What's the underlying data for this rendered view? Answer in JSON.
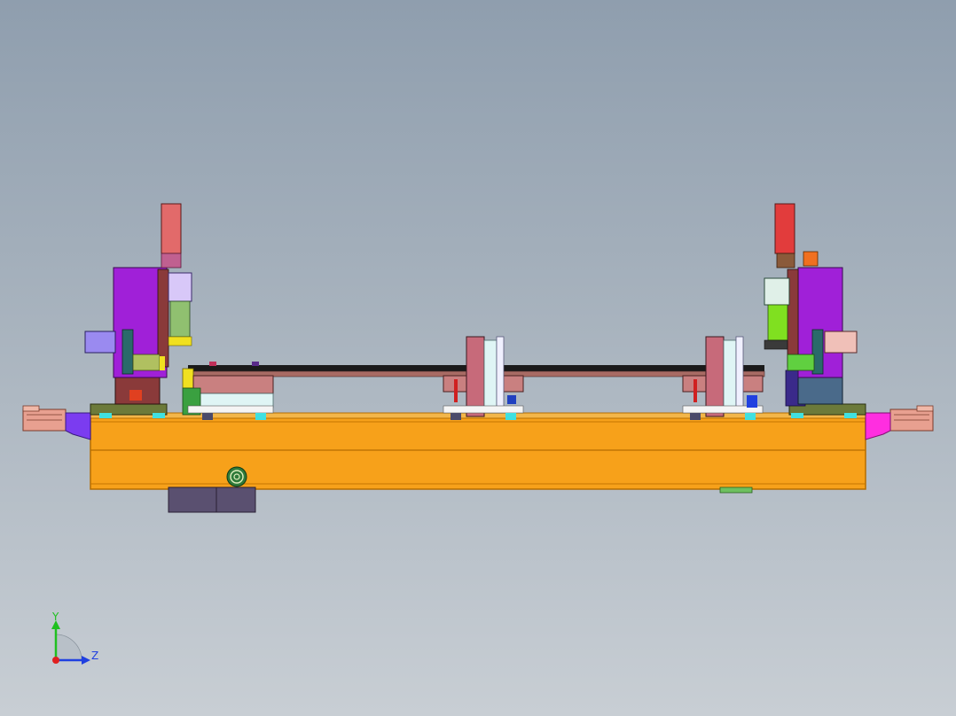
{
  "viewer": {
    "background_top": "#8f9eae",
    "background_bottom": "#c8ced4"
  },
  "colors": {
    "frame_orange": "#f7a11a",
    "frame_edge": "#c47500",
    "spindle_housing_magenta": "#a020d8",
    "motor_red": "#e23c3c",
    "rail_dark": "#1a1a1a",
    "rail_face": "#a86b64",
    "bracket_pink": "#c98080",
    "slide_pale": "#dff5f5",
    "base_plate_olive": "#6c7a3a",
    "end_cap_pink": "#e8a090",
    "wedge_blue_violet": "#7b3cf0",
    "wedge_magenta": "#ff2ee0",
    "control_box_slate": "#5a5070",
    "axis_x": "#e02020",
    "axis_y": "#20c020",
    "axis_z": "#2040e0"
  },
  "triad": {
    "y_label": "Y",
    "z_label": "Z"
  },
  "icons": {
    "triad": "coordinate-triad-icon",
    "emblem": "spiral-emblem-icon"
  }
}
